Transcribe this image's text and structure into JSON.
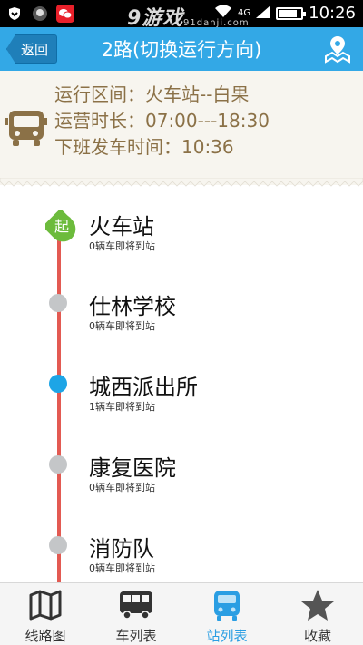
{
  "status_bar": {
    "network": "4G",
    "time": "10:26"
  },
  "watermark": {
    "main": "9游戏",
    "sub": "91danji.com"
  },
  "header": {
    "back_label": "返回",
    "title": "2路(切换运行方向)"
  },
  "info": {
    "route_range": "运行区间：火车站--白果",
    "operating_hours": "运营时长：07:00---18:30",
    "last_departure": "下班发车时间：10:36"
  },
  "stations": [
    {
      "name": "火车站",
      "status": "0辆车即将到站",
      "marker": "起"
    },
    {
      "name": "仕林学校",
      "status": "0辆车即将到站"
    },
    {
      "name": "城西派出所",
      "status": "1辆车即将到站"
    },
    {
      "name": "康复医院",
      "status": "0辆车即将到站"
    },
    {
      "name": "消防队",
      "status": "0辆车即将到站"
    }
  ],
  "tabs": [
    {
      "label": "线路图",
      "icon": "map-icon"
    },
    {
      "label": "车列表",
      "icon": "bus-icon"
    },
    {
      "label": "站列表",
      "icon": "bus-stop-icon",
      "active": true
    },
    {
      "label": "收藏",
      "icon": "star-icon"
    }
  ],
  "colors": {
    "accent": "#33a8e6",
    "route": "#e35a52",
    "start": "#6cbb3c",
    "active_stop": "#1da5e6",
    "stop": "#c4c6c8",
    "info_text": "#8b7147"
  }
}
